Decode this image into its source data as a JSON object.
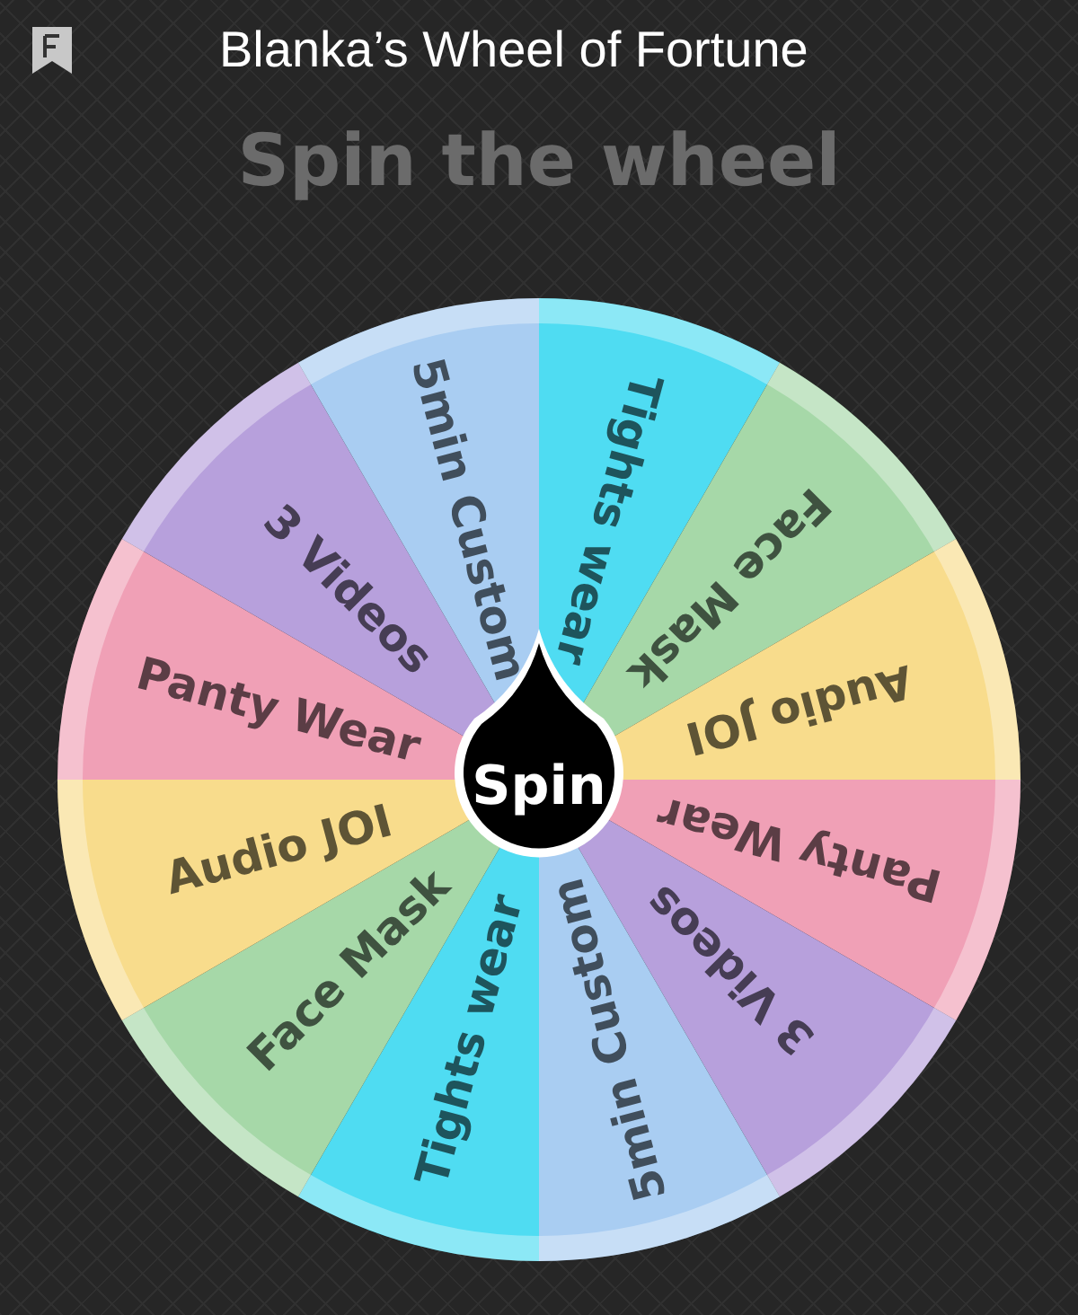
{
  "app_bar": {
    "title": "Blanka’s Wheel of Fortune"
  },
  "heading": "Spin the wheel",
  "wheel": {
    "segments": [
      {
        "label": "Tights wear",
        "color": "#4fdcf2"
      },
      {
        "label": "Face Mask",
        "color": "#a6d8a8"
      },
      {
        "label": "Audio JOI",
        "color": "#f8dc8c"
      },
      {
        "label": "Panty Wear",
        "color": "#f0a0b6"
      },
      {
        "label": "3 Videos",
        "color": "#b7a0dc"
      },
      {
        "label": "5min Custom",
        "color": "#a9cdf2"
      },
      {
        "label": "Tights wear",
        "color": "#4fdcf2"
      },
      {
        "label": "Face Mask",
        "color": "#a6d8a8"
      },
      {
        "label": "Audio JOI",
        "color": "#f8dc8c"
      },
      {
        "label": "Panty Wear",
        "color": "#f0a0b6"
      },
      {
        "label": "3 Videos",
        "color": "#b7a0dc"
      },
      {
        "label": "5min Custom",
        "color": "#a9cdf2"
      }
    ],
    "spin_button": "Spin"
  }
}
